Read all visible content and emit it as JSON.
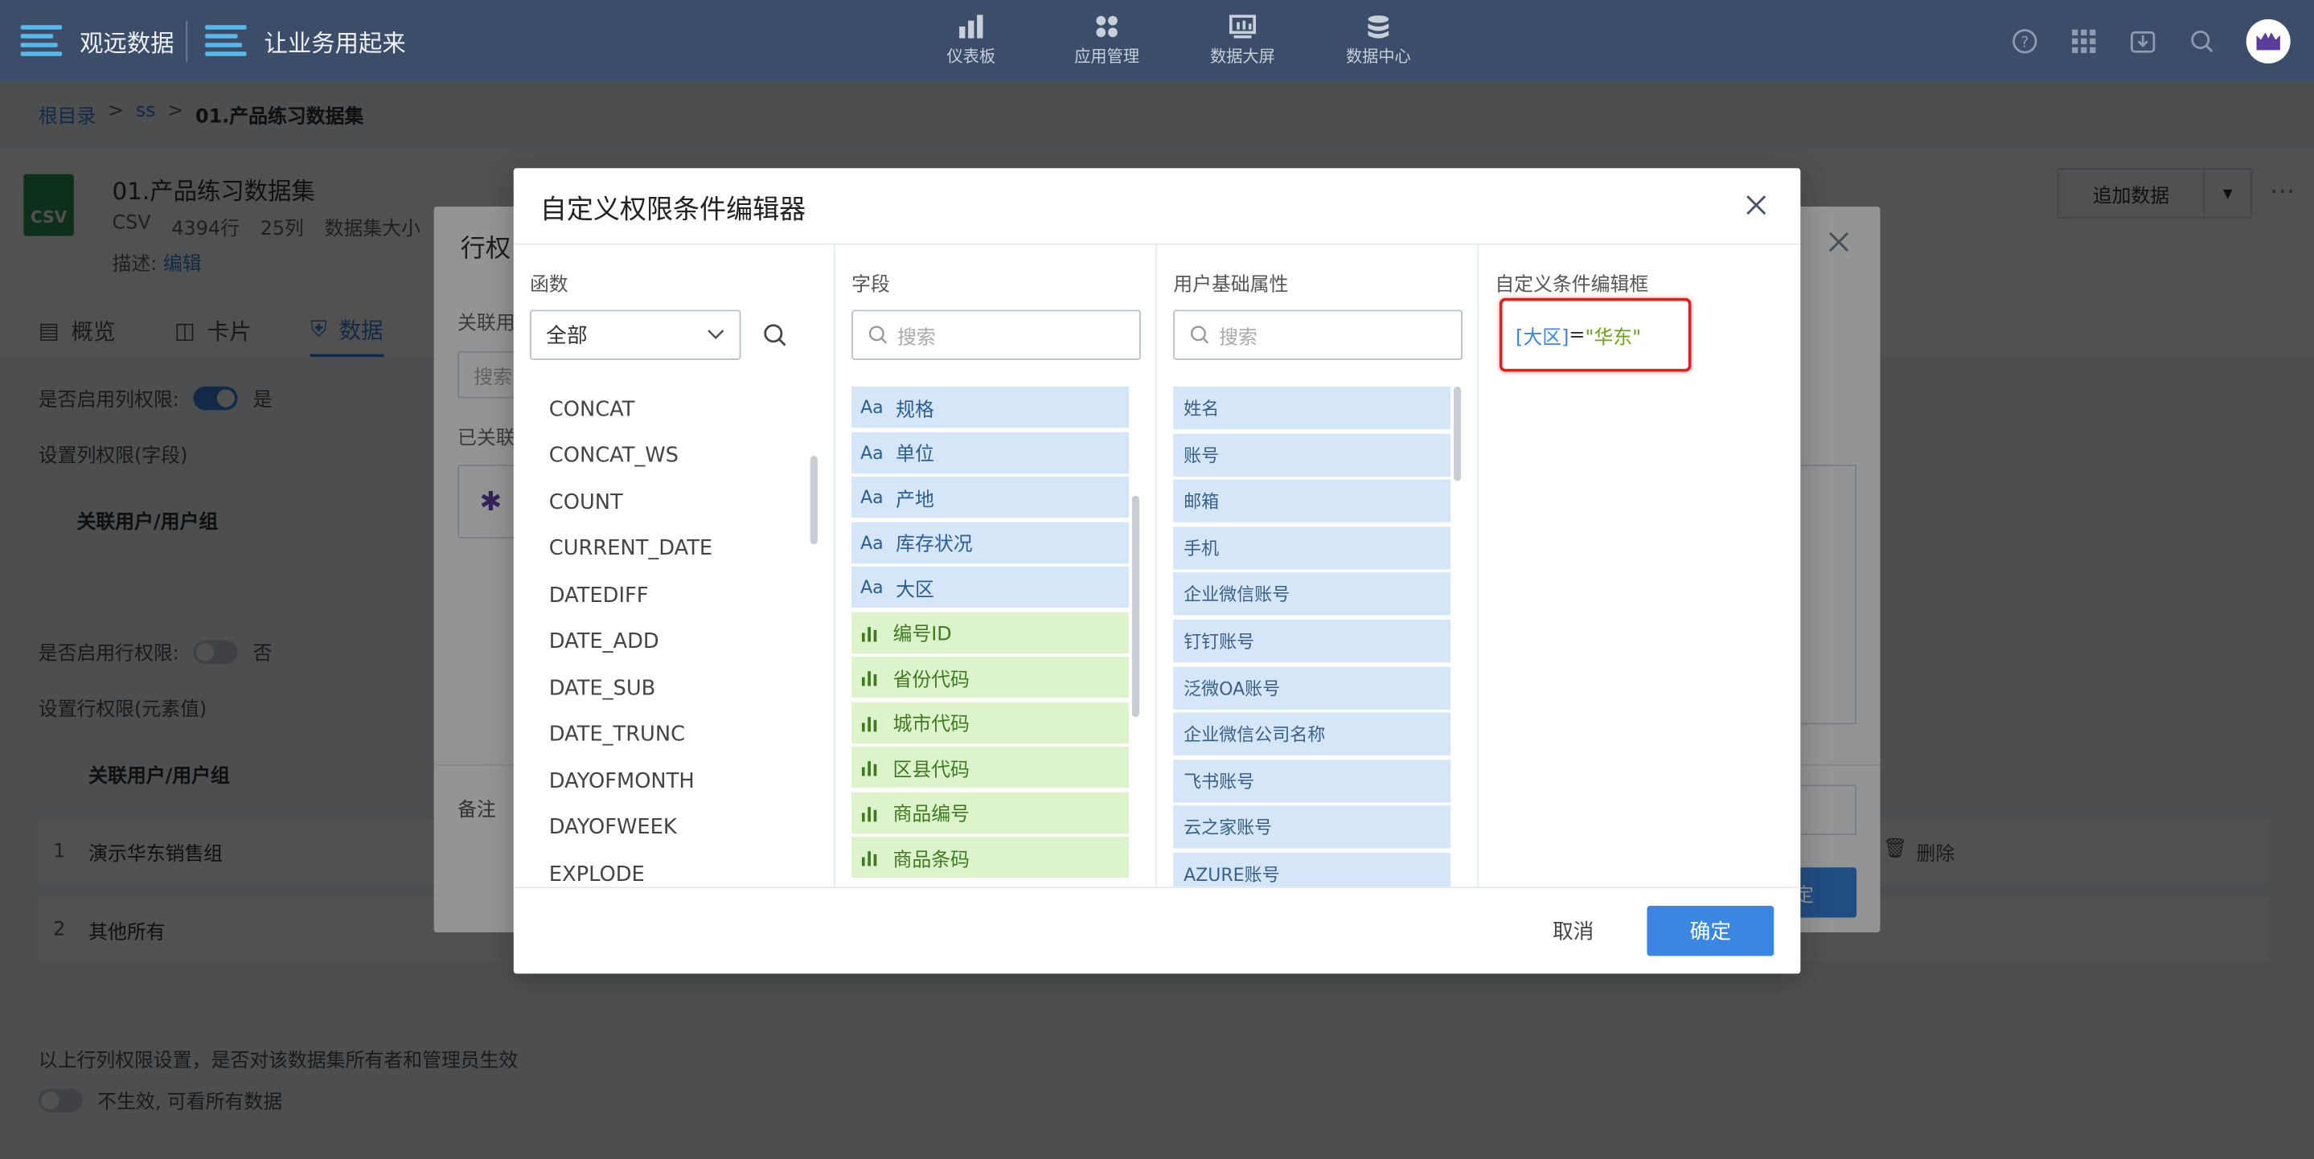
{
  "topbar": {
    "brand1": "观远数据",
    "brand2": "让业务用起来",
    "nav": [
      {
        "label": "仪表板",
        "icon": "dashboard-icon"
      },
      {
        "label": "应用管理",
        "icon": "apps-icon"
      },
      {
        "label": "数据大屏",
        "icon": "bigscreen-icon"
      },
      {
        "label": "数据中心",
        "icon": "database-icon"
      }
    ]
  },
  "breadcrumb": [
    "根目录",
    ">",
    "ss",
    ">",
    "01.产品练习数据集"
  ],
  "dataset": {
    "icon_label": "CSV",
    "title": "01.产品练习数据集",
    "meta": [
      "CSV",
      "4394行",
      "25列",
      "数据集大小"
    ],
    "desc_label": "描述:",
    "desc_link": "编辑",
    "add_data": "追加数据",
    "more": "···"
  },
  "tabs": [
    "概览",
    "卡片",
    "数据"
  ],
  "page": {
    "col_perm_label": "是否启用列权限:",
    "col_perm_value": "是",
    "col_perm_setting": "设置列权限(字段)",
    "col_header": "关联用户/用户组",
    "row_perm_label": "是否启用行权限:",
    "row_perm_value": "否",
    "row_perm_setting": "设置行权限(元素值)",
    "row_header": "关联用户/用户组",
    "rows": [
      {
        "n": "1",
        "name": "演示华东销售组",
        "action": "删除"
      },
      {
        "n": "2",
        "name": "其他所有"
      }
    ],
    "owner_note": "以上行列权限设置，是否对该数据集所有者和管理员生效",
    "owner_toggle_text": "不生效, 可看所有数据"
  },
  "row_dialog": {
    "title": "行权",
    "sub1": "关联用",
    "search_placeholder": "搜索",
    "sub2": "已关联",
    "remark": "备注",
    "ok_fragment": "定"
  },
  "modal": {
    "title": "自定义权限条件编辑器",
    "functions": {
      "title": "函数",
      "select_value": "全部",
      "items": [
        "CONCAT",
        "CONCAT_WS",
        "COUNT",
        "CURRENT_DATE",
        "DATEDIFF",
        "DATE_ADD",
        "DATE_SUB",
        "DATE_TRUNC",
        "DAYOFMONTH",
        "DAYOFWEEK",
        "EXPLODE"
      ]
    },
    "fields": {
      "title": "字段",
      "placeholder": "搜索",
      "text_badge": "Aa",
      "items": [
        {
          "label": "规格",
          "type": "text"
        },
        {
          "label": "单位",
          "type": "text"
        },
        {
          "label": "产地",
          "type": "text"
        },
        {
          "label": "库存状况",
          "type": "text"
        },
        {
          "label": "大区",
          "type": "text"
        },
        {
          "label": "编号ID",
          "type": "num"
        },
        {
          "label": "省份代码",
          "type": "num"
        },
        {
          "label": "城市代码",
          "type": "num"
        },
        {
          "label": "区县代码",
          "type": "num"
        },
        {
          "label": "商品编号",
          "type": "num"
        },
        {
          "label": "商品条码",
          "type": "num"
        }
      ]
    },
    "user_attrs": {
      "title": "用户基础属性",
      "placeholder": "搜索",
      "items": [
        "姓名",
        "账号",
        "邮箱",
        "手机",
        "企业微信账号",
        "钉钉账号",
        "泛微OA账号",
        "企业微信公司名称",
        "飞书账号",
        "云之家账号",
        "AZURE账号"
      ]
    },
    "editor": {
      "title": "自定义条件编辑框",
      "field": "[大区]",
      "operator": "=",
      "value": "\"华东\""
    },
    "cancel": "取消",
    "ok": "确定"
  },
  "colors": {
    "accent": "#3b86e0",
    "topbar": "#3b4d68",
    "text_field_bg": "#d5e6f8",
    "num_field_bg": "#ddf3cc",
    "highlight": "#e02020"
  }
}
